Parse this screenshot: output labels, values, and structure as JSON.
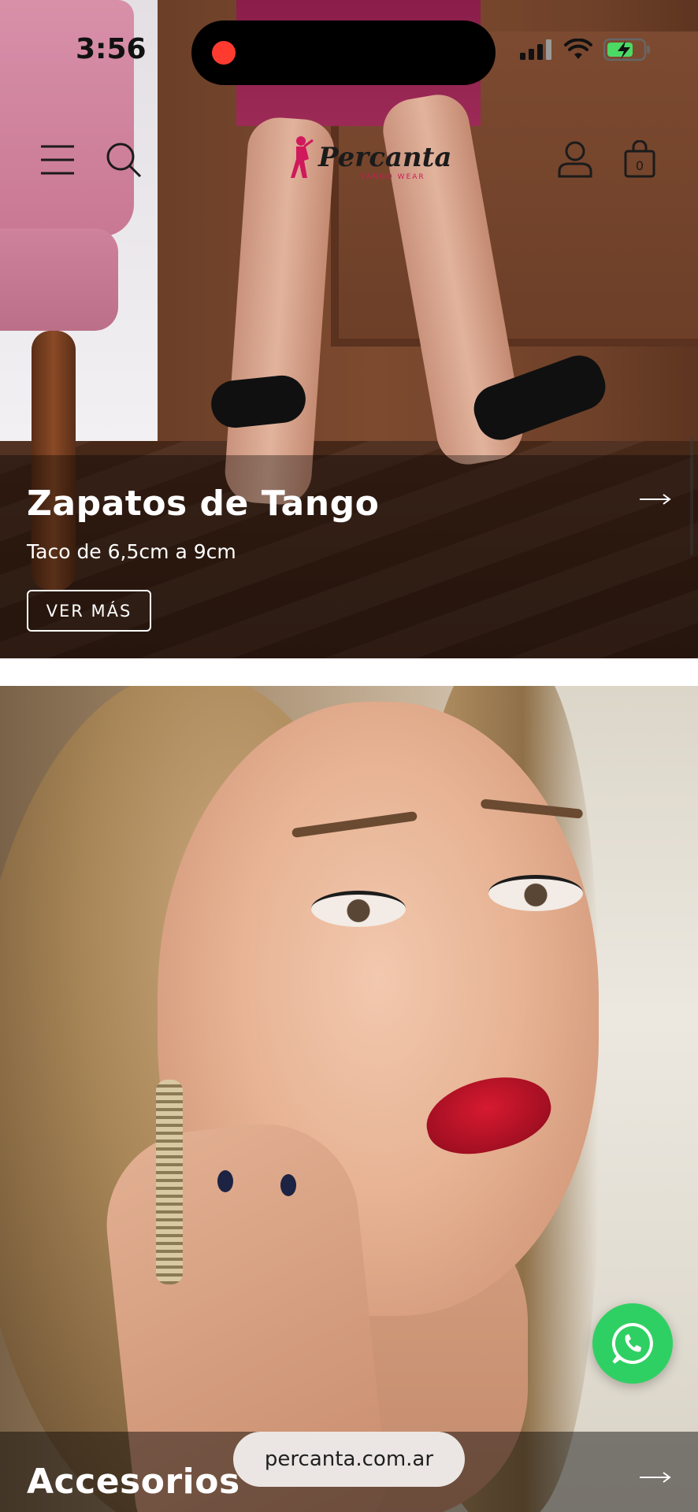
{
  "status_bar": {
    "time": "3:56"
  },
  "header": {
    "logo_text": "Percanta",
    "logo_sub": "TANGO WEAR"
  },
  "hero_shoes": {
    "title": "Zapatos de Tango",
    "subtitle": "Taco de 6,5cm a 9cm",
    "button_label": "VER MÁS"
  },
  "hero_accessories": {
    "title": "Accesorios"
  },
  "browser": {
    "url": "percanta.com.ar"
  },
  "colors": {
    "accent_pink": "#d0195c",
    "whatsapp_green": "#2fd063",
    "battery_green": "#4cd964"
  },
  "icons": {
    "menu": "menu-icon",
    "search": "search-icon",
    "account": "user-icon",
    "cart": "bag-icon",
    "whatsapp": "whatsapp-icon",
    "arrow": "arrow-right-icon"
  }
}
